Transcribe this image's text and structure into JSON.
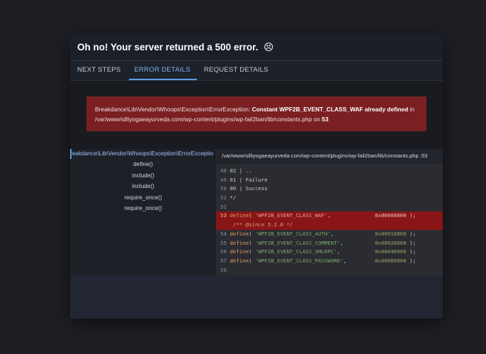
{
  "modal": {
    "title": "Oh no! Your server returned a 500 error.",
    "title_emoji": "😣"
  },
  "tabs": [
    {
      "label": "NEXT STEPS",
      "active": false
    },
    {
      "label": "ERROR DETAILS",
      "active": true
    },
    {
      "label": "REQUEST DETAILS",
      "active": false
    }
  ],
  "error": {
    "class": "Breakdance\\Lib\\Vendor\\Whoops\\Exception\\ErrorException:",
    "message": "Constant WPF2B_EVENT_CLASS_WAF already defined",
    "in_word": "in",
    "path": "/var/www/silliyogaeayurveda.com/wp-content/plugins/wp-fail2ban/lib/constants.php",
    "on_word": "on",
    "line": "53"
  },
  "frames": {
    "top": "reakdance\\Lib\\Vendor\\Whoops\\Exception\\ErrorExceptio",
    "items": [
      "define()",
      "include()",
      "include()",
      "require_once()",
      "require_once()"
    ]
  },
  "code": {
    "file_header": "/var/www/silliyogaeayurveda.com/wp-content/plugins/wp-fail2ban/lib/constants.php :53"
  },
  "colors": {
    "error_bg": "#7a2022",
    "highlight_bg": "#8a1516",
    "accent": "#5c9ee6"
  }
}
